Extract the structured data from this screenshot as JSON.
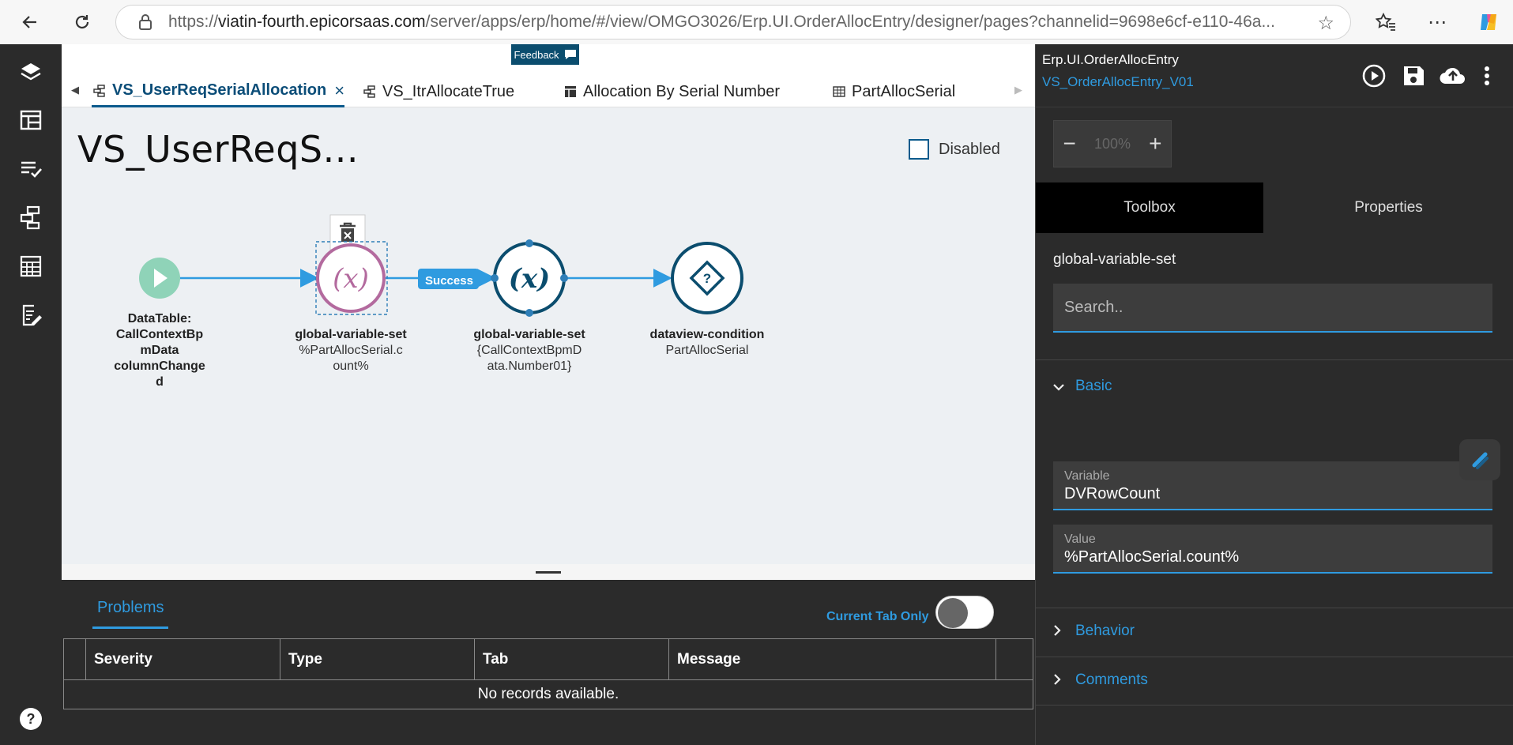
{
  "browser": {
    "url_prefix": "https://",
    "url_host": "viatin-fourth.epicorsaas.com",
    "url_path": "/server/apps/erp/home/#/view/OMGO3026/Erp.UI.OrderAllocEntry/designer/pages?channelid=9698e6cf-e110-46a..."
  },
  "tabs": [
    {
      "label": "VS_UserReqSerialAllocation",
      "close": "×"
    },
    {
      "label": "VS_ItrAllocateTrue"
    },
    {
      "label": "Allocation By Serial Number"
    },
    {
      "label": "PartAllocSerial"
    }
  ],
  "feedback_label": "Feedback",
  "canvas": {
    "title": "VS_UserReqS...",
    "disabled_label": "Disabled",
    "success_label": "Success",
    "nodes": [
      {
        "type": "",
        "lines": [
          "DataTable:",
          "CallContextBp",
          "mData",
          "columnChange",
          "d"
        ]
      },
      {
        "type": "global-variable-set",
        "lines": [
          "%PartAllocSerial.c",
          "ount%"
        ]
      },
      {
        "type": "global-variable-set",
        "lines": [
          "{CallContextBpmD",
          "ata.Number01}"
        ]
      },
      {
        "type": "dataview-condition",
        "lines": [
          "PartAllocSerial"
        ]
      }
    ]
  },
  "problems": {
    "tab_label": "Problems",
    "toggle_label": "Current Tab Only",
    "columns": [
      "Severity",
      "Type",
      "Tab",
      "Message"
    ],
    "empty_text": "No records available."
  },
  "right_panel": {
    "app_name": "Erp.UI.OrderAllocEntry",
    "page_name": "VS_OrderAllocEntry_V01",
    "zoom": "100%",
    "tabs": [
      "Toolbox",
      "Properties"
    ],
    "component_name": "global-variable-set",
    "search_placeholder": "Search..",
    "sections": {
      "basic": "Basic",
      "behavior": "Behavior",
      "comments": "Comments"
    },
    "fields": {
      "variable_label": "Variable",
      "variable_value": "DVRowCount",
      "value_label": "Value",
      "value_value": "%PartAllocSerial.count%"
    }
  },
  "colors": {
    "accent": "#2f9be0",
    "node_start": "#8fd3b8",
    "node_selected": "#b36a9e",
    "node_dark": "#0b4d6e"
  }
}
